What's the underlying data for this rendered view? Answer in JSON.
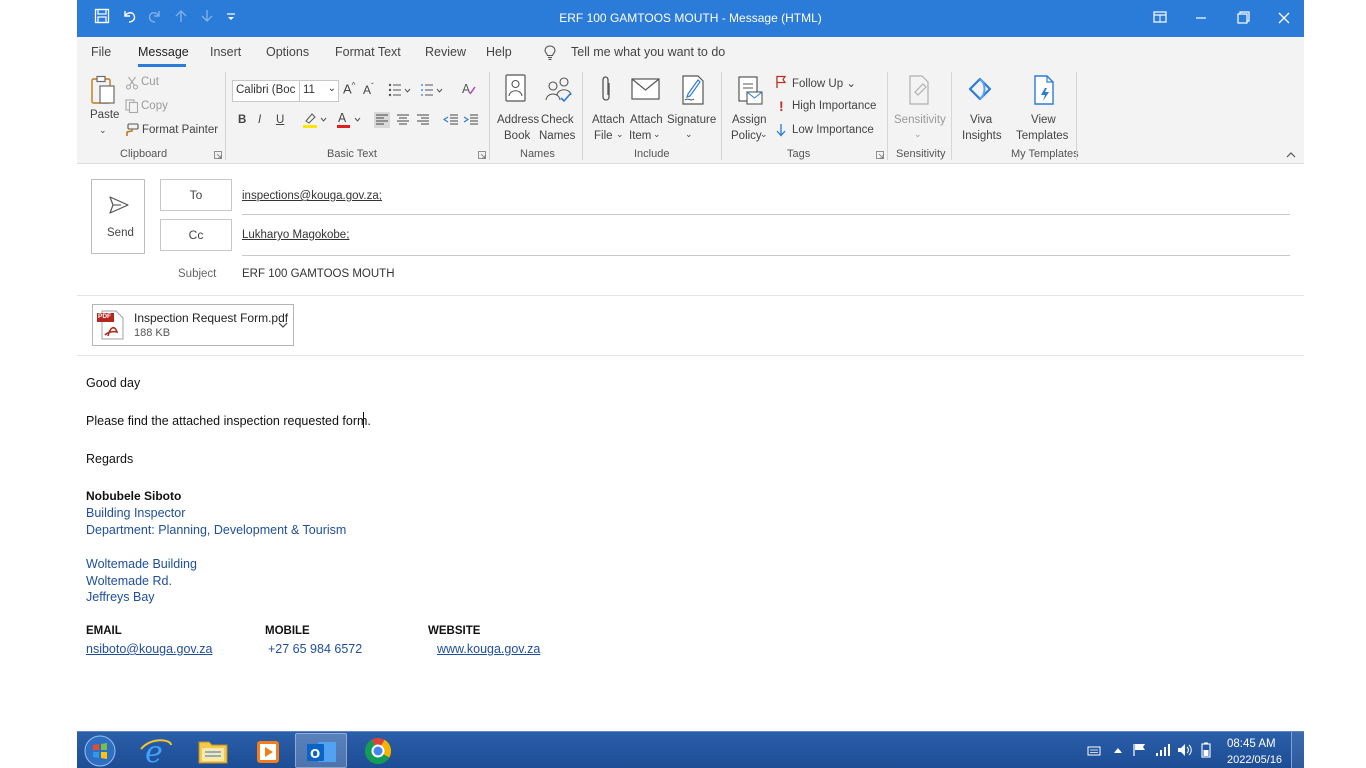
{
  "window": {
    "title": "ERF 100 GAMTOOS MOUTH  -  Message (HTML)"
  },
  "menu": {
    "items": [
      "File",
      "Message",
      "Insert",
      "Options",
      "Format Text",
      "Review",
      "Help"
    ],
    "active": "Message",
    "tell_me": "Tell me what you want to do"
  },
  "ribbon": {
    "clipboard": {
      "paste": "Paste",
      "cut": "Cut",
      "copy": "Copy",
      "format_painter": "Format Painter",
      "group_label": "Clipboard"
    },
    "basic_text": {
      "font_name": "Calibri (Boc",
      "font_size": "11",
      "group_label": "Basic Text"
    },
    "names": {
      "address_book_1": "Address",
      "address_book_2": "Book",
      "check_names_1": "Check",
      "check_names_2": "Names",
      "group_label": "Names"
    },
    "include": {
      "attach_file_1": "Attach",
      "attach_file_2": "File",
      "attach_item_1": "Attach",
      "attach_item_2": "Item",
      "signature": "Signature",
      "group_label": "Include"
    },
    "tags": {
      "assign_policy_1": "Assign",
      "assign_policy_2": "Policy",
      "follow_up": "Follow Up",
      "high_importance": "High Importance",
      "low_importance": "Low Importance",
      "group_label": "Tags"
    },
    "sensitivity": {
      "label": "Sensitivity",
      "group_label": "Sensitivity"
    },
    "templates": {
      "viva_1": "Viva",
      "viva_2": "Insights",
      "view_1": "View",
      "view_2": "Templates",
      "group_label": "My Templates"
    }
  },
  "header": {
    "send": "Send",
    "to_label": "To",
    "to_value": "inspections@kouga.gov.za;",
    "cc_label": "Cc",
    "cc_value": "Lukharyo Magokobe;",
    "subject_label": "Subject",
    "subject_value": "ERF 100 GAMTOOS MOUTH"
  },
  "attachment": {
    "name": "Inspection Request Form.pdf",
    "size": "188 KB",
    "badge": "PDF"
  },
  "body": {
    "greeting": "Good day",
    "line1": "Please find the attached inspection requested form.",
    "regards": "Regards",
    "sig_name": "Nobubele Siboto",
    "sig_title": "Building Inspector",
    "sig_dept": "Department: Planning, Development & Tourism",
    "addr1": "Woltemade Building",
    "addr2": "Woltemade Rd.",
    "addr3": "Jeffreys Bay",
    "email_label": "EMAIL",
    "mobile_label": "MOBILE",
    "website_label": "WEBSITE",
    "email_value": "nsiboto@kouga.gov.za",
    "mobile_value": "+27 65 984 6572",
    "website_value": "www.kouga.gov.za"
  },
  "taskbar": {
    "time": "08:45 AM",
    "date": "2022/05/16"
  },
  "colors": {
    "accent": "#2b7bd8",
    "signature_blue": "#1f4e9c",
    "taskbar": "#1d4d95"
  }
}
